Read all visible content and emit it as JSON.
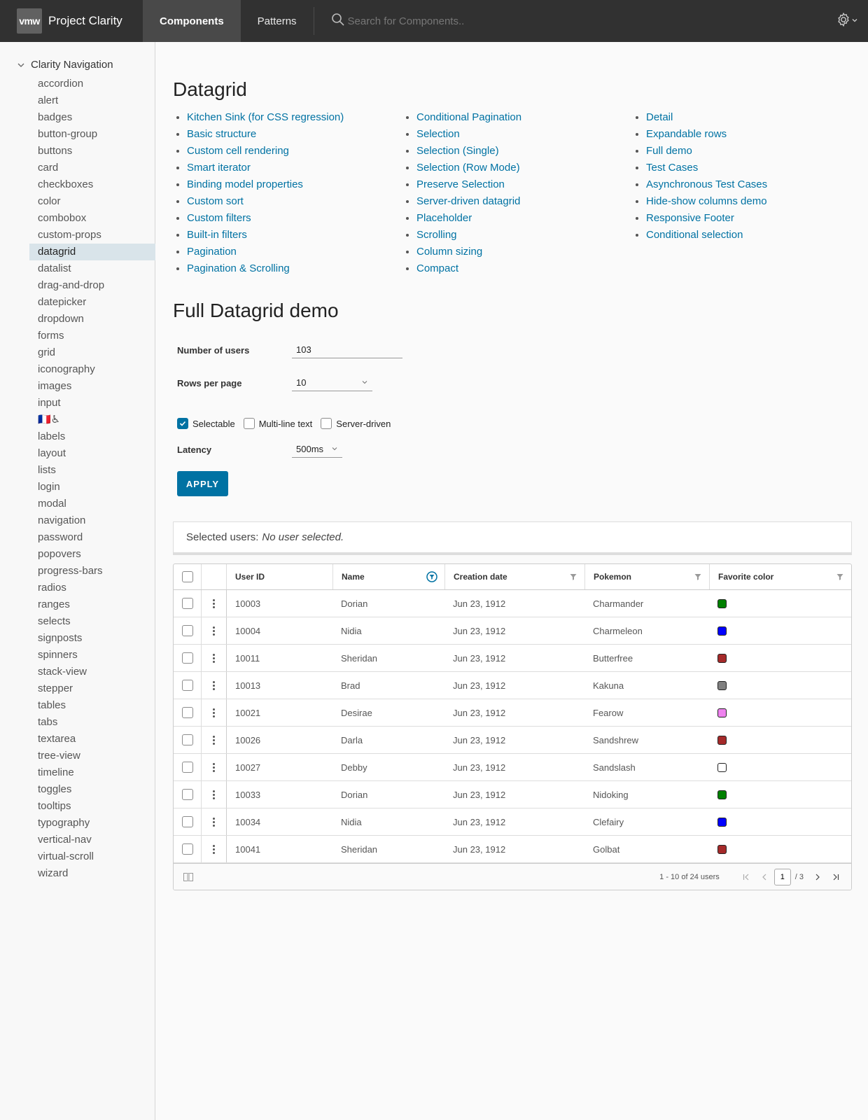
{
  "header": {
    "brand_logo": "vmw",
    "brand_title": "Project Clarity",
    "tabs": [
      "Components",
      "Patterns"
    ],
    "search_placeholder": "Search for Components.."
  },
  "sidebar": {
    "root_label": "Clarity Navigation",
    "items": [
      "accordion",
      "alert",
      "badges",
      "button-group",
      "buttons",
      "card",
      "checkboxes",
      "color",
      "combobox",
      "custom-props",
      "datagrid",
      "datalist",
      "drag-and-drop",
      "datepicker",
      "dropdown",
      "forms",
      "grid",
      "iconography",
      "images",
      "input",
      "🇫🇷♿",
      "labels",
      "layout",
      "lists",
      "login",
      "modal",
      "navigation",
      "password",
      "popovers",
      "progress-bars",
      "radios",
      "ranges",
      "selects",
      "signposts",
      "spinners",
      "stack-view",
      "stepper",
      "tables",
      "tabs",
      "textarea",
      "tree-view",
      "timeline",
      "toggles",
      "tooltips",
      "typography",
      "vertical-nav",
      "virtual-scroll",
      "wizard"
    ],
    "active_index": 10
  },
  "main": {
    "title": "Datagrid",
    "links": [
      [
        "Kitchen Sink (for CSS regression)",
        "Basic structure",
        "Custom cell rendering",
        "Smart iterator",
        "Binding model properties",
        "Custom sort",
        "Custom filters",
        "Built-in filters",
        "Pagination",
        "Pagination & Scrolling"
      ],
      [
        "Conditional Pagination",
        "Selection",
        "Selection (Single)",
        "Selection (Row Mode)",
        "Preserve Selection",
        "Server-driven datagrid",
        "Placeholder",
        "Scrolling",
        "Column sizing",
        "Compact"
      ],
      [
        "Detail",
        "Expandable rows",
        "Full demo",
        "Test Cases",
        "Asynchronous Test Cases",
        "Hide-show columns demo",
        "Responsive Footer",
        "Conditional selection"
      ]
    ],
    "subtitle": "Full Datagrid demo",
    "form": {
      "users_label": "Number of users",
      "users_value": "103",
      "rows_label": "Rows per page",
      "rows_value": "10",
      "selectable_label": "Selectable",
      "multiline_label": "Multi-line text",
      "server_label": "Server-driven",
      "latency_label": "Latency",
      "latency_value": "500ms",
      "apply_label": "APPLY"
    },
    "selected_label": "Selected users:",
    "selected_value": "No user selected."
  },
  "grid": {
    "columns": [
      "User ID",
      "Name",
      "Creation date",
      "Pokemon",
      "Favorite color"
    ],
    "rows": [
      {
        "id": "10003",
        "name": "Dorian",
        "date": "Jun 23, 1912",
        "pokemon": "Charmander",
        "color": "#008000"
      },
      {
        "id": "10004",
        "name": "Nidia",
        "date": "Jun 23, 1912",
        "pokemon": "Charmeleon",
        "color": "#0000ff"
      },
      {
        "id": "10011",
        "name": "Sheridan",
        "date": "Jun 23, 1912",
        "pokemon": "Butterfree",
        "color": "#a52a2a"
      },
      {
        "id": "10013",
        "name": "Brad",
        "date": "Jun 23, 1912",
        "pokemon": "Kakuna",
        "color": "#808080"
      },
      {
        "id": "10021",
        "name": "Desirae",
        "date": "Jun 23, 1912",
        "pokemon": "Fearow",
        "color": "#ee82ee"
      },
      {
        "id": "10026",
        "name": "Darla",
        "date": "Jun 23, 1912",
        "pokemon": "Sandshrew",
        "color": "#a52a2a"
      },
      {
        "id": "10027",
        "name": "Debby",
        "date": "Jun 23, 1912",
        "pokemon": "Sandslash",
        "color": "#ffffff"
      },
      {
        "id": "10033",
        "name": "Dorian",
        "date": "Jun 23, 1912",
        "pokemon": "Nidoking",
        "color": "#008000"
      },
      {
        "id": "10034",
        "name": "Nidia",
        "date": "Jun 23, 1912",
        "pokemon": "Clefairy",
        "color": "#0000ff"
      },
      {
        "id": "10041",
        "name": "Sheridan",
        "date": "Jun 23, 1912",
        "pokemon": "Golbat",
        "color": "#a52a2a"
      }
    ],
    "footer_summary": "1 - 10 of 24 users",
    "current_page": "1",
    "total_pages": "/ 3"
  },
  "colors": {
    "accent": "#0072a3",
    "header_bg": "#313131",
    "active_nav": "#d9e4ea"
  }
}
